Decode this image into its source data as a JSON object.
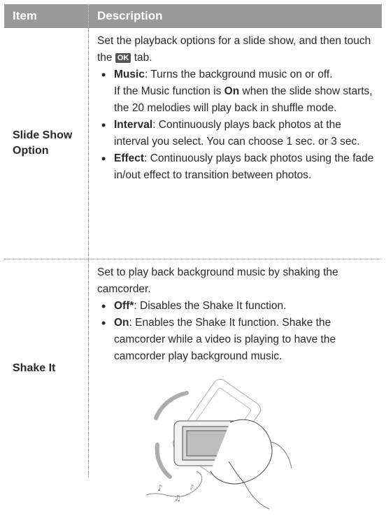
{
  "table": {
    "header": {
      "item": "Item",
      "description": "Description"
    },
    "rows": [
      {
        "item": "Slide Show Option",
        "intro_pre": "Set the playback options for a slide show, and then touch the",
        "ok_label": "OK",
        "intro_post": "tab.",
        "bullets": [
          {
            "term": "Music",
            "text": ": Turns the background music on or off.",
            "extra_pre": "If the Music function is",
            "extra_term": "On",
            "extra_post": "when the slide show starts, the 20 melodies will play back in shuffle mode."
          },
          {
            "term": "Interval",
            "text": ": Continuously plays back photos at the interval you select. You can choose 1 sec. or 3 sec."
          },
          {
            "term": "Effect",
            "text": ": Continuously plays back photos using the fade in/out effect to transition between photos."
          }
        ]
      },
      {
        "item": "Shake It",
        "intro": "Set to play back background music by shaking the camcorder.",
        "bullets": [
          {
            "term": "Off*",
            "text": ": Disables the Shake It function."
          },
          {
            "term": "On",
            "text": ":  Enables the Shake It function. Shake the camcorder while a video is playing to have the camcorder play background music."
          }
        ],
        "illustration_icon": "hand-shaking-camcorder-icon"
      }
    ]
  }
}
